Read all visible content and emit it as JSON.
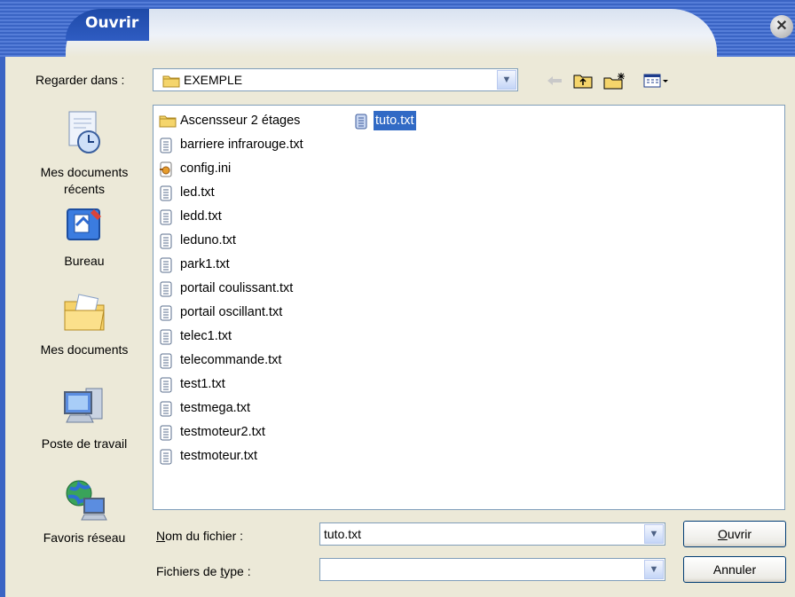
{
  "window": {
    "title": "Ouvrir",
    "close_glyph": "✕"
  },
  "lookin": {
    "label": "Regarder dans :",
    "value": "EXEMPLE"
  },
  "toolbar": {
    "icons": [
      "back-arrow-icon",
      "up-folder-icon",
      "new-folder-icon",
      "view-menu-icon"
    ]
  },
  "places": [
    {
      "label_line1": "Mes documents",
      "label_line2": "récents",
      "icon": "recent-documents-icon"
    },
    {
      "label_line1": "Bureau",
      "label_line2": "",
      "icon": "desktop-icon"
    },
    {
      "label_line1": "Mes documents",
      "label_line2": "",
      "icon": "my-documents-icon"
    },
    {
      "label_line1": "Poste de travail",
      "label_line2": "",
      "icon": "my-computer-icon"
    },
    {
      "label_line1": "Favoris réseau",
      "label_line2": "",
      "icon": "network-places-icon"
    }
  ],
  "files": [
    {
      "name": "Ascensseur 2 étages",
      "type": "folder"
    },
    {
      "name": "barriere infrarouge.txt",
      "type": "txt"
    },
    {
      "name": "config.ini",
      "type": "ini"
    },
    {
      "name": "led.txt",
      "type": "txt"
    },
    {
      "name": "ledd.txt",
      "type": "txt"
    },
    {
      "name": "leduno.txt",
      "type": "txt"
    },
    {
      "name": "park1.txt",
      "type": "txt"
    },
    {
      "name": "portail coulissant.txt",
      "type": "txt"
    },
    {
      "name": "portail oscillant.txt",
      "type": "txt"
    },
    {
      "name": "telec1.txt",
      "type": "txt"
    },
    {
      "name": "telecommande.txt",
      "type": "txt"
    },
    {
      "name": "test1.txt",
      "type": "txt"
    },
    {
      "name": "testmega.txt",
      "type": "txt"
    },
    {
      "name": "testmoteur2.txt",
      "type": "txt"
    },
    {
      "name": "testmoteur.txt",
      "type": "txt"
    },
    {
      "name": "tuto.txt",
      "type": "txt",
      "selected": true
    }
  ],
  "filename": {
    "label_prefix": "",
    "label_key": "N",
    "label_rest": "om du fichier :",
    "value": "tuto.txt"
  },
  "filetype": {
    "label_prefix": "Fichiers de ",
    "label_key": "t",
    "label_rest": "ype :",
    "value": ""
  },
  "buttons": {
    "open_key": "O",
    "open_rest": "uvrir",
    "cancel": "Annuler"
  },
  "colors": {
    "title_bar": "#3a64c4",
    "selection": "#316ac5",
    "dialog_bg": "#ece9d8"
  }
}
